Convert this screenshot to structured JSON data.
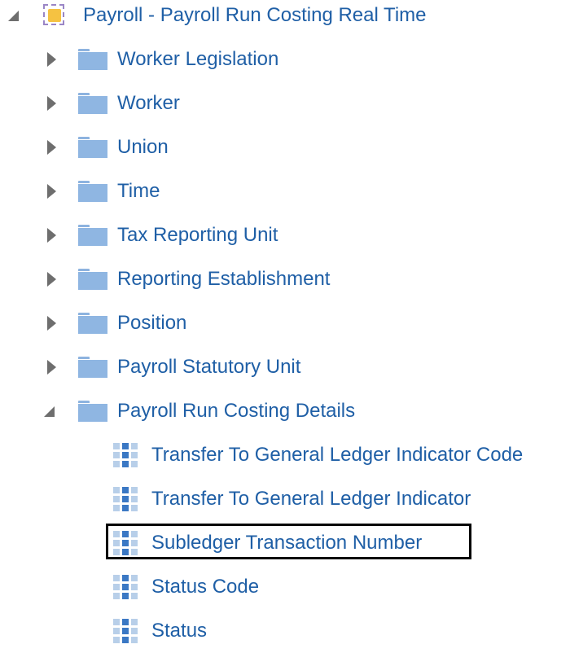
{
  "tree": {
    "root": {
      "label": "Payroll - Payroll Run Costing Real Time",
      "icon": "subject-area-icon",
      "expanded": true
    },
    "folders": [
      {
        "label": "Worker Legislation",
        "expanded": false
      },
      {
        "label": "Worker",
        "expanded": false
      },
      {
        "label": "Union",
        "expanded": false
      },
      {
        "label": "Time",
        "expanded": false
      },
      {
        "label": "Tax Reporting Unit",
        "expanded": false
      },
      {
        "label": "Reporting Establishment",
        "expanded": false
      },
      {
        "label": "Position",
        "expanded": false
      },
      {
        "label": "Payroll Statutory Unit",
        "expanded": false
      },
      {
        "label": "Payroll Run Costing Details",
        "expanded": true
      }
    ],
    "columns": [
      {
        "label": "Transfer To General Ledger Indicator Code",
        "highlighted": false
      },
      {
        "label": "Transfer To General Ledger Indicator",
        "highlighted": false
      },
      {
        "label": "Subledger Transaction Number",
        "highlighted": true
      },
      {
        "label": "Status Code",
        "highlighted": false
      },
      {
        "label": "Status",
        "highlighted": false
      }
    ]
  },
  "colors": {
    "label": "#1f5fa6",
    "folder": "#8fb6e2",
    "toggle": "#6e6e6e",
    "highlight_border": "#000000"
  }
}
